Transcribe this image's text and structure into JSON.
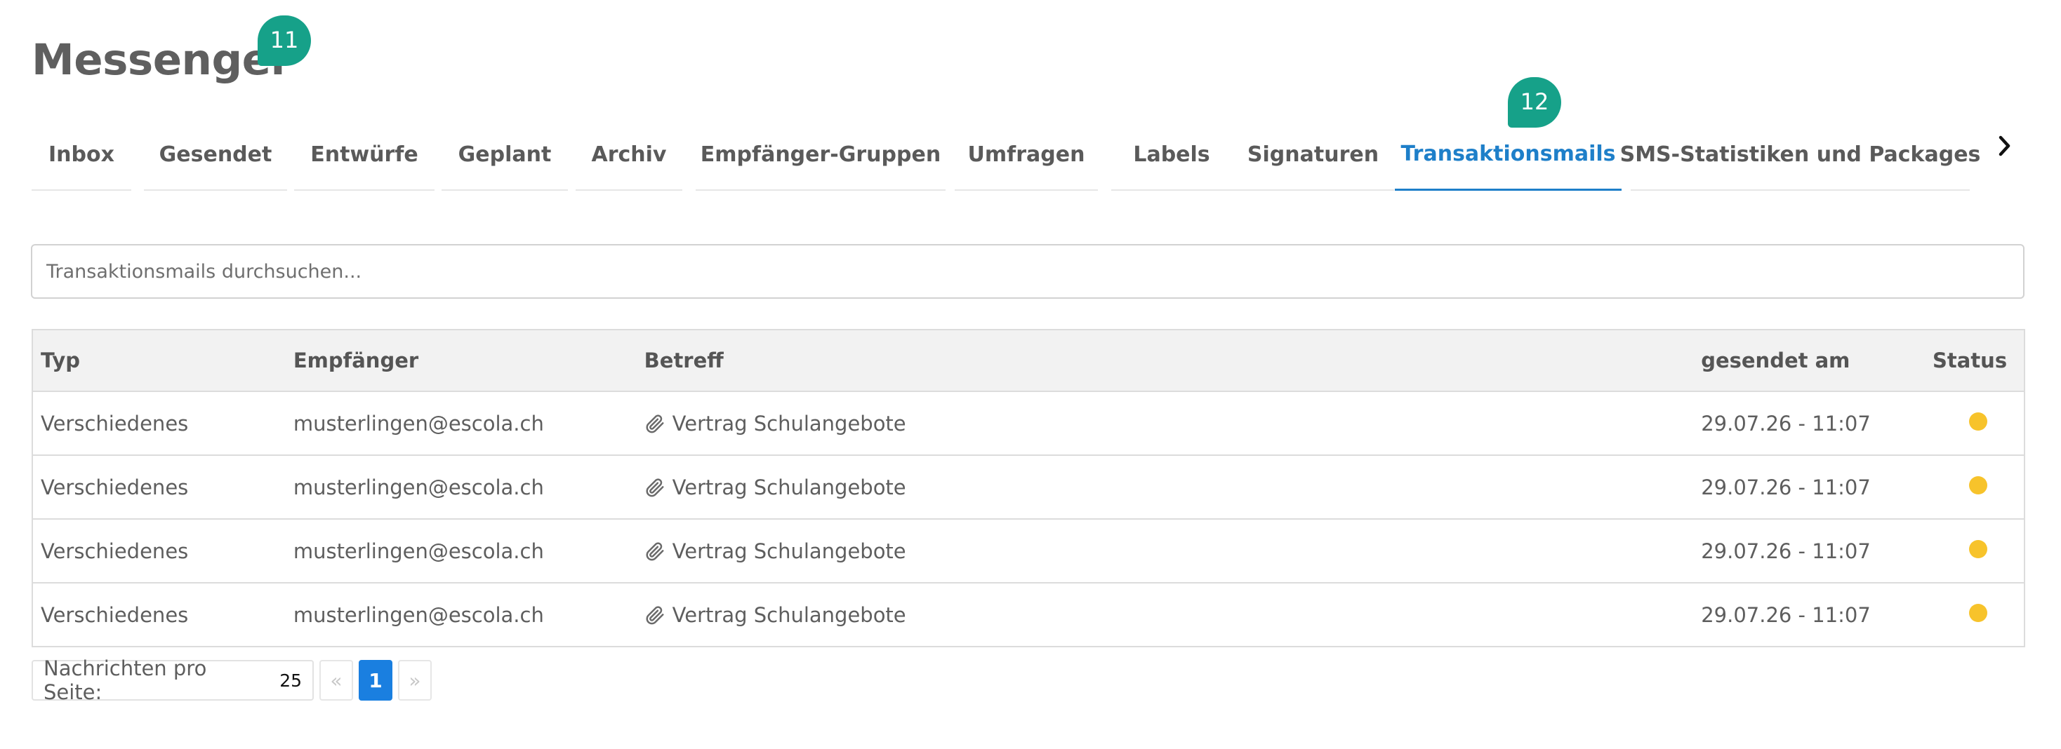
{
  "app": {
    "title": "Messenger",
    "title_badge": "11"
  },
  "tabs": [
    {
      "label": "Inbox"
    },
    {
      "label": "Gesendet"
    },
    {
      "label": "Entwürfe"
    },
    {
      "label": "Geplant"
    },
    {
      "label": "Archiv"
    },
    {
      "label": "Empfänger-Gruppen"
    },
    {
      "label": "Umfragen"
    },
    {
      "label": "Labels"
    },
    {
      "label": "Signaturen"
    },
    {
      "label": "Transaktionsmails",
      "badge": "12",
      "active": true
    },
    {
      "label": "SMS-Statistiken und Packages"
    }
  ],
  "tabs_scroll_icon": "chevron-right-icon",
  "search": {
    "placeholder": "Transaktionsmails durchsuchen...",
    "value": ""
  },
  "table": {
    "headers": {
      "type": "Typ",
      "recipient": "Empfänger",
      "subject": "Betreff",
      "sent": "gesendet am",
      "status": "Status"
    },
    "rows": [
      {
        "type": "Verschiedenes",
        "recipient": "musterlingen@escola.ch",
        "subject": "Vertrag Schulangebote",
        "sent": "29.07.26 - 11:07",
        "status_color": "#f7c32b",
        "attachment_icon": "paperclip-icon"
      },
      {
        "type": "Verschiedenes",
        "recipient": "musterlingen@escola.ch",
        "subject": "Vertrag Schulangebote",
        "sent": "29.07.26 - 11:07",
        "status_color": "#f7c32b",
        "attachment_icon": "paperclip-icon"
      },
      {
        "type": "Verschiedenes",
        "recipient": "musterlingen@escola.ch",
        "subject": "Vertrag Schulangebote",
        "sent": "29.07.26 - 11:07",
        "status_color": "#f7c32b",
        "attachment_icon": "paperclip-icon"
      },
      {
        "type": "Verschiedenes",
        "recipient": "musterlingen@escola.ch",
        "subject": "Vertrag Schulangebote",
        "sent": "29.07.26 - 11:07",
        "status_color": "#f7c32b",
        "attachment_icon": "paperclip-icon"
      }
    ]
  },
  "pagination": {
    "per_page_label": "Nachrichten pro Seite:",
    "per_page_value": "25",
    "prev": "«",
    "current": "1",
    "next": "»"
  },
  "colors": {
    "accent": "#1e7fc9",
    "badge": "#16a189",
    "status_pending": "#f7c32b",
    "pager_active": "#1a7fe0"
  }
}
